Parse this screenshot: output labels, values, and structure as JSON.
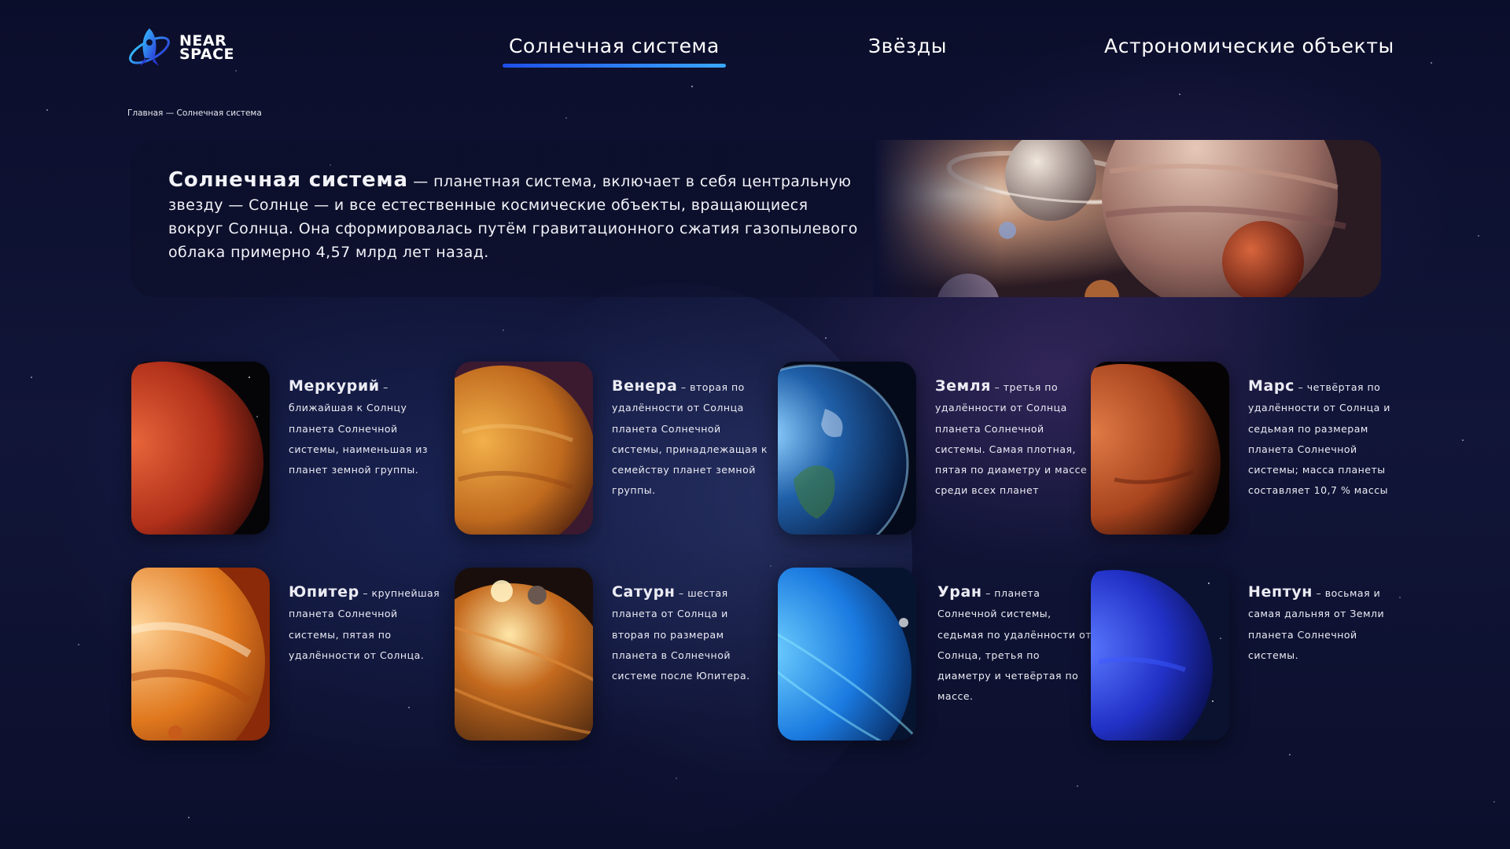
{
  "brand": {
    "line1": "NEAR",
    "line2": "SPACE"
  },
  "nav": [
    {
      "label": "Солнечная система",
      "active": true
    },
    {
      "label": "Звёзды",
      "active": false
    },
    {
      "label": "Астрономические объекты",
      "active": false
    }
  ],
  "breadcrumb": "Главная — Солнечная система",
  "hero": {
    "term": "Солнечная система",
    "text": " — планетная система, включает в себя центральную звезду — Солнце — и все естественные космические объекты, вращающиеся вокруг Солнца. Она сформировалась путём гравитационного сжатия газопылевого облака примерно 4,57 млрд лет назад."
  },
  "planets": [
    {
      "name": "Меркурий",
      "text": " – ближайшая к Солнцу планета Солнечной системы, наименьшая из планет земной группы."
    },
    {
      "name": "Венера",
      "text": " – вторая по удалённости от Солнца планета Солнечной системы, принадлежащая к семейству планет земной группы."
    },
    {
      "name": "Земля",
      "text": " – третья по удалённости от Солнца планета Солнечной системы. Самая плотная, пятая по диаметру и массе среди всех планет"
    },
    {
      "name": "Марс",
      "text": " – четвёртая по удалённости от Солнца и седьмая по размерам планета Солнечной системы; масса планеты составляет 10,7 % массы"
    },
    {
      "name": "Юпитер",
      "text": " – крупнейшая планета Солнечной системы, пятая по удалённости от Солнца."
    },
    {
      "name": "Сатурн",
      "text": " – шестая планета от Солнца и вторая по размерам планета в Солнечной системе после Юпитера."
    },
    {
      "name": "Уран",
      "text": " – планета Солнечной системы, седьмая по удалённости от Солнца, третья по диаметру и четвёртая по массе."
    },
    {
      "name": "Нептун",
      "text": " – восьмая и самая дальняя от Земли планета Солнечной системы."
    }
  ],
  "colors": {
    "accent": "#1e4fe8",
    "accent_light": "#3aa7ff",
    "background": "#0d1030"
  }
}
